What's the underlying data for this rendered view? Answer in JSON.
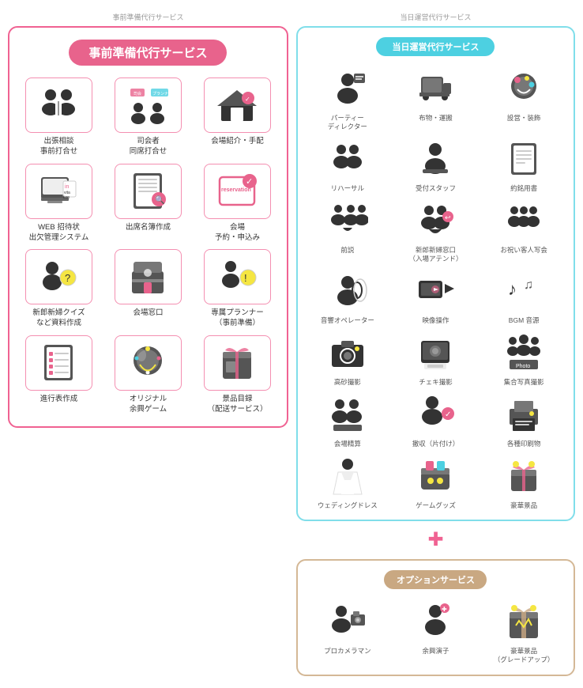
{
  "left": {
    "header": "事前準備代行サービス",
    "title": "事前準備代行サービス",
    "items": [
      {
        "label": "出張相談\n事前打合せ",
        "icon": "meeting"
      },
      {
        "label": "司会者\n同席打合せ",
        "icon": "mc"
      },
      {
        "label": "会場紹介・手配",
        "icon": "venue"
      },
      {
        "label": "WEB招待状\n出欠管理システム",
        "icon": "invitation"
      },
      {
        "label": "出席名簿作成",
        "icon": "roster"
      },
      {
        "label": "会場\n予約・申込み",
        "icon": "reservation"
      },
      {
        "label": "新郎新婦クイズ\nなど資料作成",
        "icon": "quiz"
      },
      {
        "label": "会場窓口",
        "icon": "counter"
      },
      {
        "label": "専属プランナー\n（事前準備）",
        "icon": "planner"
      },
      {
        "label": "進行表作成",
        "icon": "schedule"
      },
      {
        "label": "オリジナル\n余興ゲーム",
        "icon": "game"
      },
      {
        "label": "景品目録\n（配送サービス）",
        "icon": "gift"
      }
    ]
  },
  "right": {
    "header": "当日運営代行サービス",
    "title": "当日運営代行サービス",
    "items": [
      {
        "label": "パーティー\nディレクター",
        "icon": "director"
      },
      {
        "label": "布物・運搬",
        "icon": "transport"
      },
      {
        "label": "設営・装飾",
        "icon": "decoration"
      },
      {
        "label": "リハーサル",
        "icon": "rehearsal"
      },
      {
        "label": "受付スタッフ",
        "icon": "reception"
      },
      {
        "label": "約銘用書",
        "icon": "document"
      },
      {
        "label": "前説",
        "icon": "intro"
      },
      {
        "label": "新郎新婦窓口\n（入場アテンド）",
        "icon": "attend"
      },
      {
        "label": "お祝い客人写会",
        "icon": "photo_guest"
      },
      {
        "label": "音響オペレーター",
        "icon": "audio"
      },
      {
        "label": "映像操作",
        "icon": "video"
      },
      {
        "label": "BGM音源",
        "icon": "bgm"
      },
      {
        "label": "高砂撮影",
        "icon": "stage_photo"
      },
      {
        "label": "チェキ撮影",
        "icon": "instant_photo"
      },
      {
        "label": "集合写真撮影",
        "icon": "group_photo"
      },
      {
        "label": "会場精算",
        "icon": "checkout"
      },
      {
        "label": "撤収（片付け）",
        "icon": "cleanup"
      },
      {
        "label": "各種印刷物",
        "icon": "printing"
      },
      {
        "label": "ウェディングドレス",
        "icon": "dress"
      },
      {
        "label": "ゲームグッズ",
        "icon": "game_goods"
      },
      {
        "label": "豪華景品",
        "icon": "luxury_prize"
      }
    ]
  },
  "option": {
    "title": "オプションサービス",
    "items": [
      {
        "label": "プロカメラマン",
        "icon": "photographer"
      },
      {
        "label": "余興演子",
        "icon": "performer"
      },
      {
        "label": "豪華景品\n（グレードアップ）",
        "icon": "grade_up"
      }
    ]
  }
}
